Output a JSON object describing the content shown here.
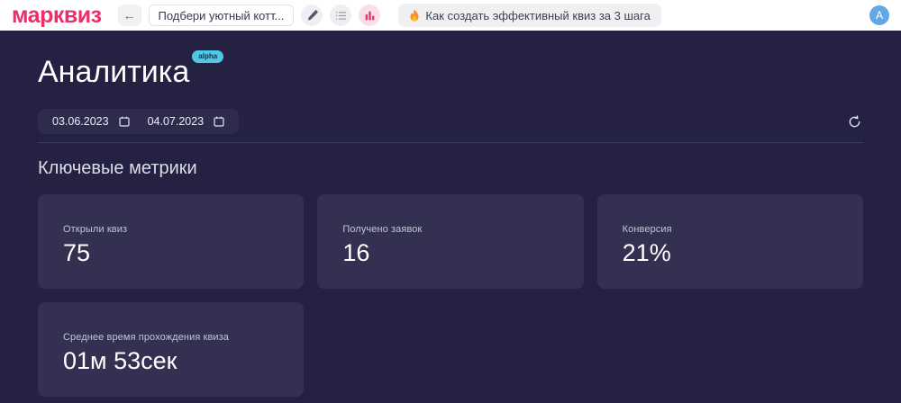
{
  "topbar": {
    "logo": "марквиз",
    "back_icon": "arrow-left-icon",
    "back_glyph": "←",
    "quiz_name": "Подбери уютный котт...",
    "icons": {
      "edit": "pencil-icon",
      "questions": "list-icon",
      "analytics": "bar-chart-icon",
      "flame": "flame-icon"
    },
    "promo_label": "Как создать эффективный квиз за 3 шага",
    "avatar_initial": "A"
  },
  "page": {
    "title": "Аналитика",
    "badge": "alpha",
    "date_from": "03.06.2023",
    "date_to": "04.07.2023",
    "calendar_icon": "calendar-icon",
    "refresh_icon": "refresh-icon"
  },
  "metrics": {
    "heading": "Ключевые метрики",
    "cards": [
      {
        "label": "Открыли квиз",
        "value": "75"
      },
      {
        "label": "Получено заявок",
        "value": "16"
      },
      {
        "label": "Конверсия",
        "value": "21%"
      },
      {
        "label": "Среднее время прохождения квиза",
        "value": "01м 53сек"
      }
    ]
  },
  "colors": {
    "brand_pink": "#ee2e68",
    "main_background": "#242143",
    "card_background": "#333051",
    "alpha_badge": "#4fc8e8",
    "avatar_blue": "#63a8e6",
    "active_icon_background": "#fadee8"
  }
}
